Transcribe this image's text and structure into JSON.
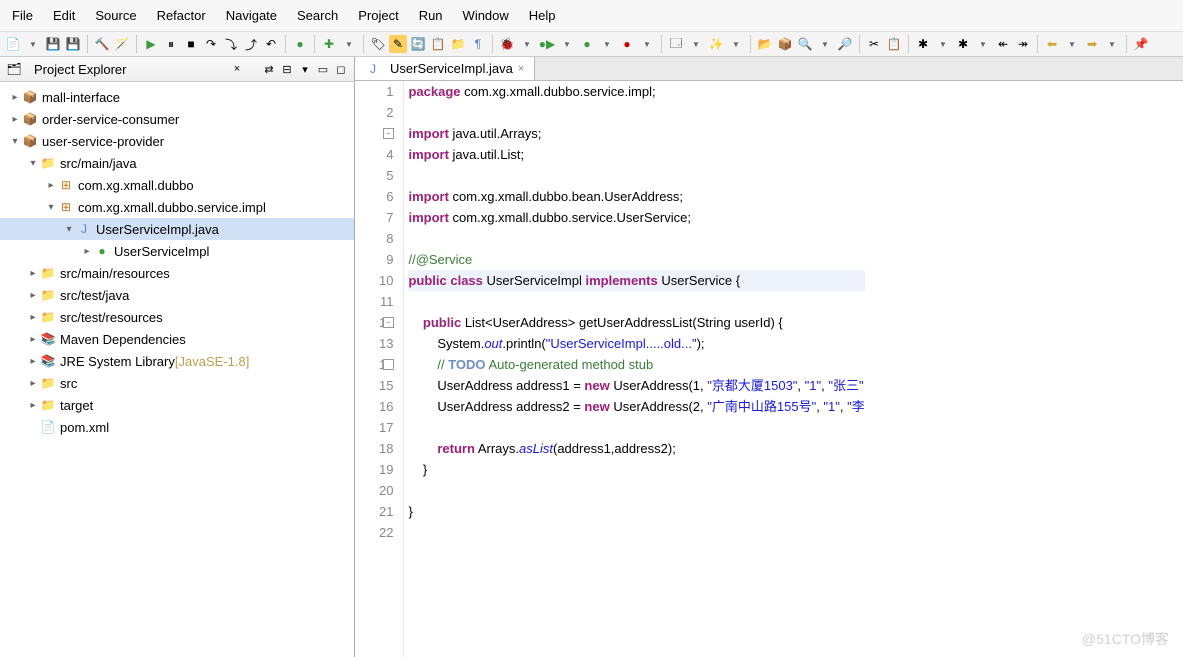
{
  "menus": [
    "File",
    "Edit",
    "Source",
    "Refactor",
    "Navigate",
    "Search",
    "Project",
    "Run",
    "Window",
    "Help"
  ],
  "explorer": {
    "title": "Project Explorer",
    "items": [
      {
        "d": 0,
        "t": ">",
        "i": "📦",
        "cls": "pkg",
        "label": "mall-interface"
      },
      {
        "d": 0,
        "t": ">",
        "i": "📦",
        "cls": "pkg",
        "label": "order-service-consumer"
      },
      {
        "d": 0,
        "t": "v",
        "i": "📦",
        "cls": "pkg",
        "label": "user-service-provider"
      },
      {
        "d": 1,
        "t": "v",
        "i": "📁",
        "cls": "fld",
        "label": "src/main/java"
      },
      {
        "d": 2,
        "t": ">",
        "i": "⊞",
        "cls": "pkg",
        "label": "com.xg.xmall.dubbo"
      },
      {
        "d": 2,
        "t": "v",
        "i": "⊞",
        "cls": "pkg",
        "label": "com.xg.xmall.dubbo.service.impl"
      },
      {
        "d": 3,
        "t": "v",
        "i": "J",
        "cls": "jfile",
        "label": "UserServiceImpl.java",
        "sel": true
      },
      {
        "d": 4,
        "t": ">",
        "i": "●",
        "cls": "cls",
        "label": "UserServiceImpl"
      },
      {
        "d": 1,
        "t": ">",
        "i": "📁",
        "cls": "fld",
        "label": "src/main/resources"
      },
      {
        "d": 1,
        "t": ">",
        "i": "📁",
        "cls": "fld",
        "label": "src/test/java"
      },
      {
        "d": 1,
        "t": ">",
        "i": "📁",
        "cls": "fld",
        "label": "src/test/resources"
      },
      {
        "d": 1,
        "t": ">",
        "i": "📚",
        "cls": "jar",
        "label": "Maven Dependencies"
      },
      {
        "d": 1,
        "t": ">",
        "i": "📚",
        "cls": "jar",
        "label": "JRE System Library",
        "suffix": " [JavaSE-1.8]"
      },
      {
        "d": 1,
        "t": ">",
        "i": "📁",
        "cls": "fld",
        "label": "src"
      },
      {
        "d": 1,
        "t": ">",
        "i": "📁",
        "cls": "fld",
        "label": "target"
      },
      {
        "d": 1,
        "t": " ",
        "i": "📄",
        "cls": "pom",
        "label": "pom.xml"
      }
    ]
  },
  "editor": {
    "tab": "UserServiceImpl.java",
    "lines": [
      {
        "n": 1,
        "tokens": [
          {
            "c": "kw",
            "t": "package"
          },
          {
            "t": " com.xg.xmall.dubbo.service.impl;"
          }
        ]
      },
      {
        "n": 2,
        "tokens": []
      },
      {
        "n": 3,
        "fold": "-",
        "tokens": [
          {
            "c": "kw",
            "t": "import"
          },
          {
            "t": " java.util.Arrays;"
          }
        ]
      },
      {
        "n": 4,
        "tokens": [
          {
            "c": "kw",
            "t": "import"
          },
          {
            "t": " java.util.List;"
          }
        ]
      },
      {
        "n": 5,
        "tokens": []
      },
      {
        "n": 6,
        "tokens": [
          {
            "c": "kw",
            "t": "import"
          },
          {
            "t": " com.xg.xmall.dubbo.bean.UserAddress;"
          }
        ]
      },
      {
        "n": 7,
        "tokens": [
          {
            "c": "kw",
            "t": "import"
          },
          {
            "t": " com.xg.xmall.dubbo.service.UserService;"
          }
        ]
      },
      {
        "n": 8,
        "tokens": []
      },
      {
        "n": 9,
        "tokens": [
          {
            "c": "cmt",
            "t": "//@Service"
          }
        ]
      },
      {
        "n": 10,
        "hl": true,
        "tokens": [
          {
            "c": "kw",
            "t": "public class"
          },
          {
            "t": " UserServiceImpl "
          },
          {
            "c": "kw",
            "t": "implements"
          },
          {
            "t": " UserService {"
          }
        ]
      },
      {
        "n": 11,
        "tokens": []
      },
      {
        "n": 12,
        "fold": "-",
        "tokens": [
          {
            "t": "    "
          },
          {
            "c": "kw",
            "t": "public"
          },
          {
            "t": " List<UserAddress> getUserAddressList(String userId) {"
          }
        ]
      },
      {
        "n": 13,
        "tokens": [
          {
            "t": "        System."
          },
          {
            "c": "ital",
            "t": "out"
          },
          {
            "t": ".println("
          },
          {
            "c": "str",
            "t": "\"UserServiceImpl.....old...\""
          },
          {
            "t": ");"
          }
        ]
      },
      {
        "n": 14,
        "fold": " ",
        "tokens": [
          {
            "t": "        "
          },
          {
            "c": "cmt",
            "t": "// "
          },
          {
            "c": "todo",
            "t": "TODO"
          },
          {
            "c": "cmt",
            "t": " Auto-generated method stub"
          }
        ]
      },
      {
        "n": 15,
        "tokens": [
          {
            "t": "        UserAddress address1 = "
          },
          {
            "c": "kw",
            "t": "new"
          },
          {
            "t": " UserAddress(1, "
          },
          {
            "c": "str",
            "t": "\"京都大厦1503\""
          },
          {
            "t": ", "
          },
          {
            "c": "str",
            "t": "\"1\""
          },
          {
            "t": ", "
          },
          {
            "c": "str",
            "t": "\"张三\""
          }
        ]
      },
      {
        "n": 16,
        "tokens": [
          {
            "t": "        UserAddress address2 = "
          },
          {
            "c": "kw",
            "t": "new"
          },
          {
            "t": " UserAddress(2, "
          },
          {
            "c": "str",
            "t": "\"广南中山路155号\""
          },
          {
            "t": ", "
          },
          {
            "c": "str",
            "t": "\"1\""
          },
          {
            "t": ", "
          },
          {
            "c": "str",
            "t": "\"李"
          }
        ]
      },
      {
        "n": 17,
        "tokens": []
      },
      {
        "n": 18,
        "tokens": [
          {
            "t": "        "
          },
          {
            "c": "kw",
            "t": "return"
          },
          {
            "t": " Arrays."
          },
          {
            "c": "ital",
            "t": "asList"
          },
          {
            "t": "(address1,address2);"
          }
        ]
      },
      {
        "n": 19,
        "tokens": [
          {
            "t": "    }"
          }
        ]
      },
      {
        "n": 20,
        "tokens": []
      },
      {
        "n": 21,
        "tokens": [
          {
            "t": "}"
          }
        ]
      },
      {
        "n": 22,
        "tokens": []
      }
    ]
  },
  "watermark": "@51CTO博客"
}
